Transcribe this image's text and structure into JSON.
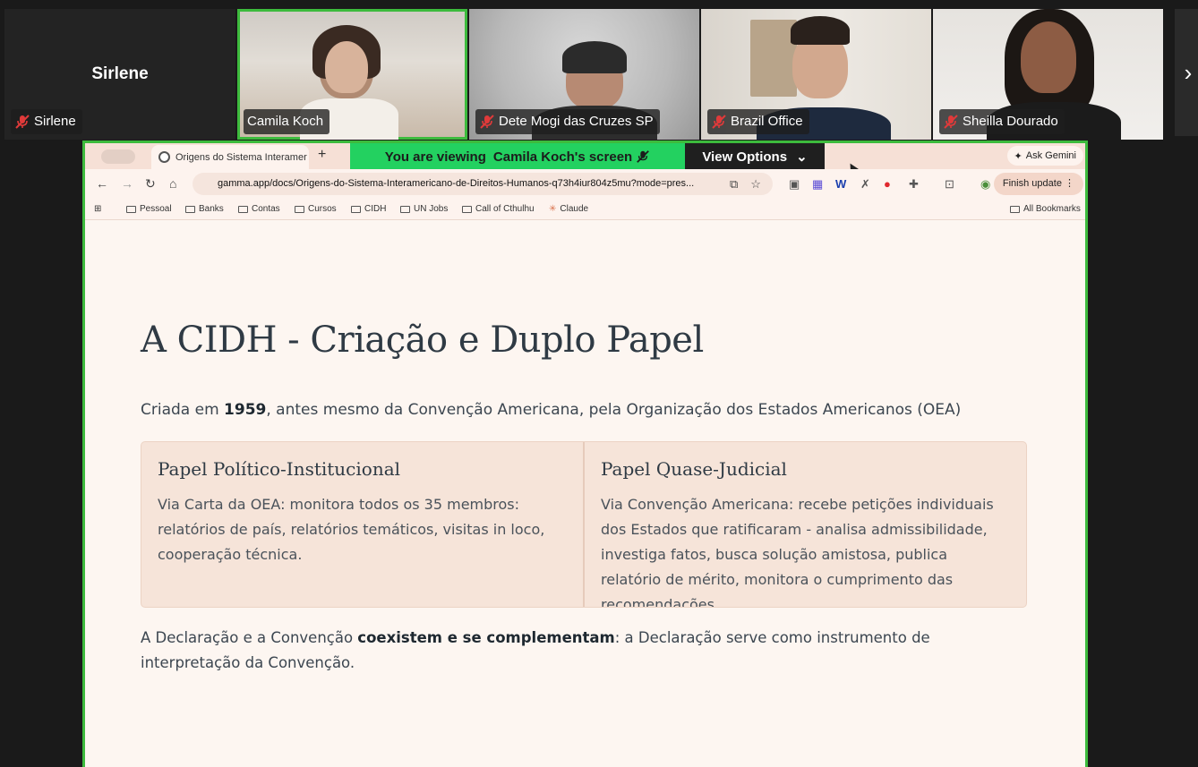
{
  "participants": [
    {
      "name": "Sirlene",
      "big_label": "Sirlene",
      "muted": true
    },
    {
      "name": "Camila Koch",
      "muted": false,
      "active": true
    },
    {
      "name": "Dete Mogi das Cruzes SP",
      "muted": true
    },
    {
      "name": "Brazil Office",
      "muted": true
    },
    {
      "name": "Sheilla Dourado",
      "muted": true
    }
  ],
  "next_icon": "chevron-right-icon",
  "banner": {
    "prefix": "You are viewing",
    "who": "Camila Koch's screen",
    "view_options": "View Options"
  },
  "browser": {
    "tab_title": "Origens do Sistema Interamer",
    "new_tab": "+",
    "ask_gemini": "Ask Gemini",
    "url": "gamma.app/docs/Origens-do-Sistema-Interamericano-de-Direitos-Humanos-q73h4iur804z5mu?mode=pres...",
    "finish_update": "Finish update",
    "bookmarks": [
      "Pessoal",
      "Banks",
      "Contas",
      "Cursos",
      "CIDH",
      "UN Jobs",
      "Call of Cthulhu",
      "Claude"
    ],
    "all_bookmarks": "All Bookmarks"
  },
  "slide": {
    "title": "A CIDH - Criação e Duplo Papel",
    "intro_before": "Criada em ",
    "intro_year": "1959",
    "intro_after": ", antes mesmo da Convenção Americana, pela Organização dos Estados Americanos (OEA)",
    "cards": [
      {
        "heading": "Papel Político-Institucional",
        "body": "Via Carta da OEA: monitora todos os 35 membros: relatórios de país, relatórios temáticos, visitas in loco, cooperação técnica."
      },
      {
        "heading": "Papel Quase-Judicial",
        "body": "Via Convenção Americana: recebe petições individuais dos Estados que ratificaram - analisa admissibilidade, investiga fatos, busca solução amistosa, publica relatório de mérito, monitora o cumprimento das recomendações."
      }
    ],
    "outro_before": "A Declaração e a Convenção ",
    "outro_bold": "coexistem e se complementam",
    "outro_after": ": a Declaração serve como instrumento de interpretação da Convenção."
  }
}
